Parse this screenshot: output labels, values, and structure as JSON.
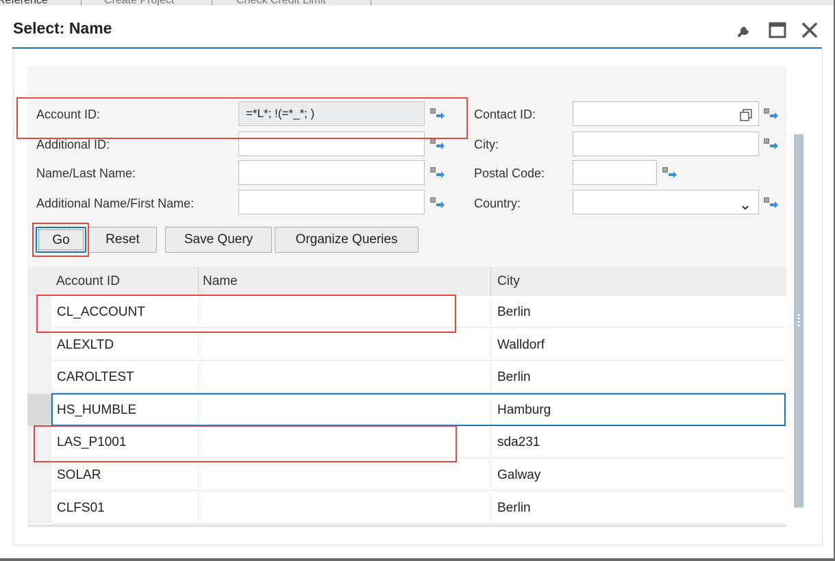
{
  "background": {
    "tabs": [
      "Reference",
      "Create Project",
      "Check Credit Limit"
    ]
  },
  "dialog": {
    "title": "Select: Name",
    "icons": [
      "wrench-icon",
      "maximize-icon",
      "close-icon"
    ]
  },
  "filters": {
    "left": [
      {
        "label": "Account ID:",
        "value": "=*L*; !(=*_*; )"
      },
      {
        "label": "Additional ID:",
        "value": ""
      },
      {
        "label": "Name/Last Name:",
        "value": ""
      },
      {
        "label": "Additional Name/First Name:",
        "value": ""
      }
    ],
    "right": [
      {
        "label": "Contact ID:",
        "value": ""
      },
      {
        "label": "City:",
        "value": ""
      },
      {
        "label": "Postal Code:",
        "value": ""
      },
      {
        "label": "Country:",
        "value": ""
      }
    ]
  },
  "buttons": {
    "go": "Go",
    "reset": "Reset",
    "save_query": "Save Query",
    "organize_queries": "Organize Queries"
  },
  "table": {
    "columns": [
      "Account ID",
      "Name",
      "City"
    ],
    "rows": [
      {
        "account_id": "CL_ACCOUNT",
        "name": "",
        "city": "Berlin"
      },
      {
        "account_id": "ALEXLTD",
        "name": "",
        "city": "Walldorf"
      },
      {
        "account_id": "CAROLTEST",
        "name": "",
        "city": "Berlin"
      },
      {
        "account_id": "HS_HUMBLE",
        "name": "",
        "city": "Hamburg"
      },
      {
        "account_id": "LAS_P1001",
        "name": "",
        "city": "sda231"
      },
      {
        "account_id": "SOLAR",
        "name": "",
        "city": "Galway"
      },
      {
        "account_id": "CLFS01",
        "name": "",
        "city": "Berlin"
      }
    ]
  },
  "colors": {
    "accent": "#1f74b4",
    "highlight": "#e2483d"
  }
}
